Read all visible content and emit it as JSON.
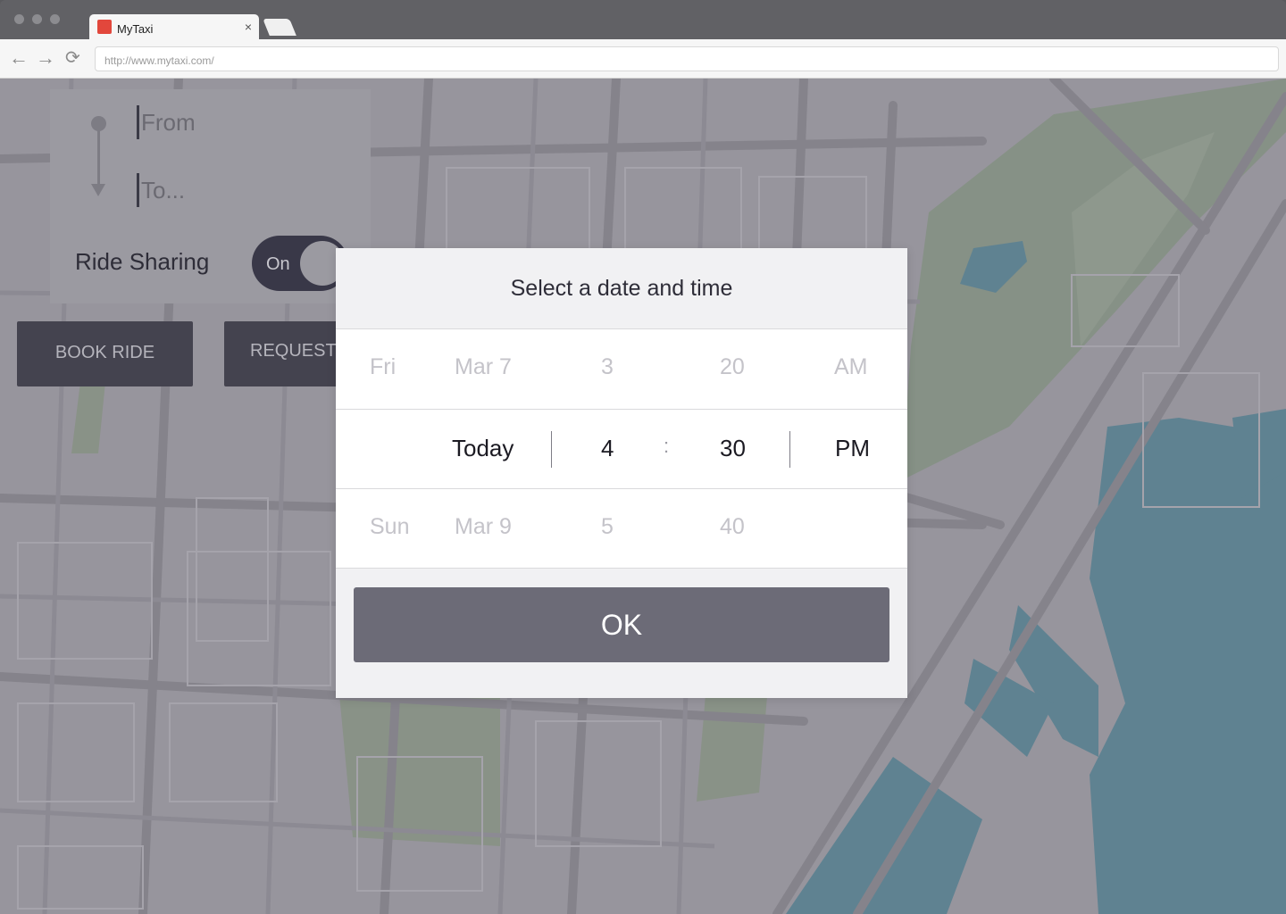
{
  "browser": {
    "tab_title": "MyTaxi",
    "tab_close": "×",
    "url": "http://www.mytaxi.com/",
    "favicon_color": "#e2473c"
  },
  "route": {
    "from_placeholder": "From",
    "to_placeholder": "To..."
  },
  "ride_sharing": {
    "label": "Ride Sharing",
    "toggle_text": "On"
  },
  "actions": {
    "book_label": "BOOK RIDE",
    "request_label": "REQUEST R"
  },
  "dialog": {
    "title": "Select a date and time",
    "rows": {
      "prev": {
        "day": "Fri",
        "date": "Mar 7",
        "hour": "3",
        "minute": "20",
        "period": "AM"
      },
      "selected": {
        "date": "Today",
        "hour": "4",
        "separator": ":",
        "minute": "30",
        "period": "PM"
      },
      "next": {
        "day": "Sun",
        "date": "Mar 9",
        "hour": "5",
        "minute": "40"
      }
    },
    "ok_label": "OK"
  },
  "colors": {
    "map_land": "#a09fa6",
    "map_road": "#8a8990",
    "map_park": "#8c9a8a",
    "map_water": "#5c8898",
    "dark_ui": "#44434f"
  }
}
